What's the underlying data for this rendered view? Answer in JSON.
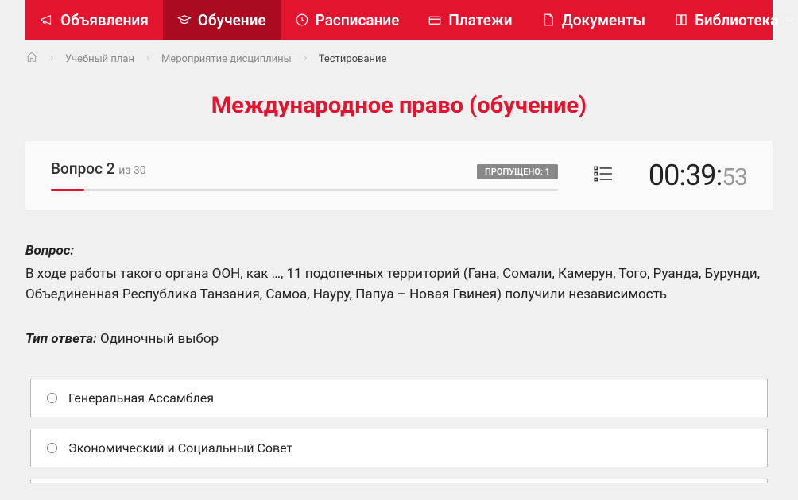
{
  "nav": {
    "items": [
      {
        "label": "Объявления",
        "icon": "megaphone-icon",
        "active": false
      },
      {
        "label": "Обучение",
        "icon": "graduation-cap-icon",
        "active": true
      },
      {
        "label": "Расписание",
        "icon": "clock-icon",
        "active": false
      },
      {
        "label": "Платежи",
        "icon": "payment-icon",
        "active": false
      },
      {
        "label": "Документы",
        "icon": "document-icon",
        "active": false
      },
      {
        "label": "Библиотека",
        "icon": "book-icon",
        "active": false,
        "dropdown": true
      }
    ]
  },
  "breadcrumb": {
    "items": [
      {
        "label": "Учебный план",
        "link": true
      },
      {
        "label": "Мероприятие дисциплины",
        "link": true
      },
      {
        "label": "Тестирование",
        "link": false
      }
    ]
  },
  "title": "Международное право (обучение)",
  "progress": {
    "question_label": "Вопрос 2",
    "of_label": "из 30",
    "skipped_label": "ПРОПУЩЕНО: 1",
    "timer_main": "00:39:",
    "timer_seconds": "53"
  },
  "question": {
    "label": "Вопрос:",
    "text": "В ходе работы такого органа ООН, как …, 11 подопечных территорий (Гана, Сомали, Камерун, Того, Руанда, Бурунди, Объединенная Республика Танзания, Самоа, Науру, Папуа – Новая Гвинея) получили независимость",
    "answer_type_label": "Тип ответа:",
    "answer_type_value": "Одиночный выбор",
    "options": [
      "Генеральная Ассамблея",
      "Экономический и Социальный Совет"
    ]
  }
}
